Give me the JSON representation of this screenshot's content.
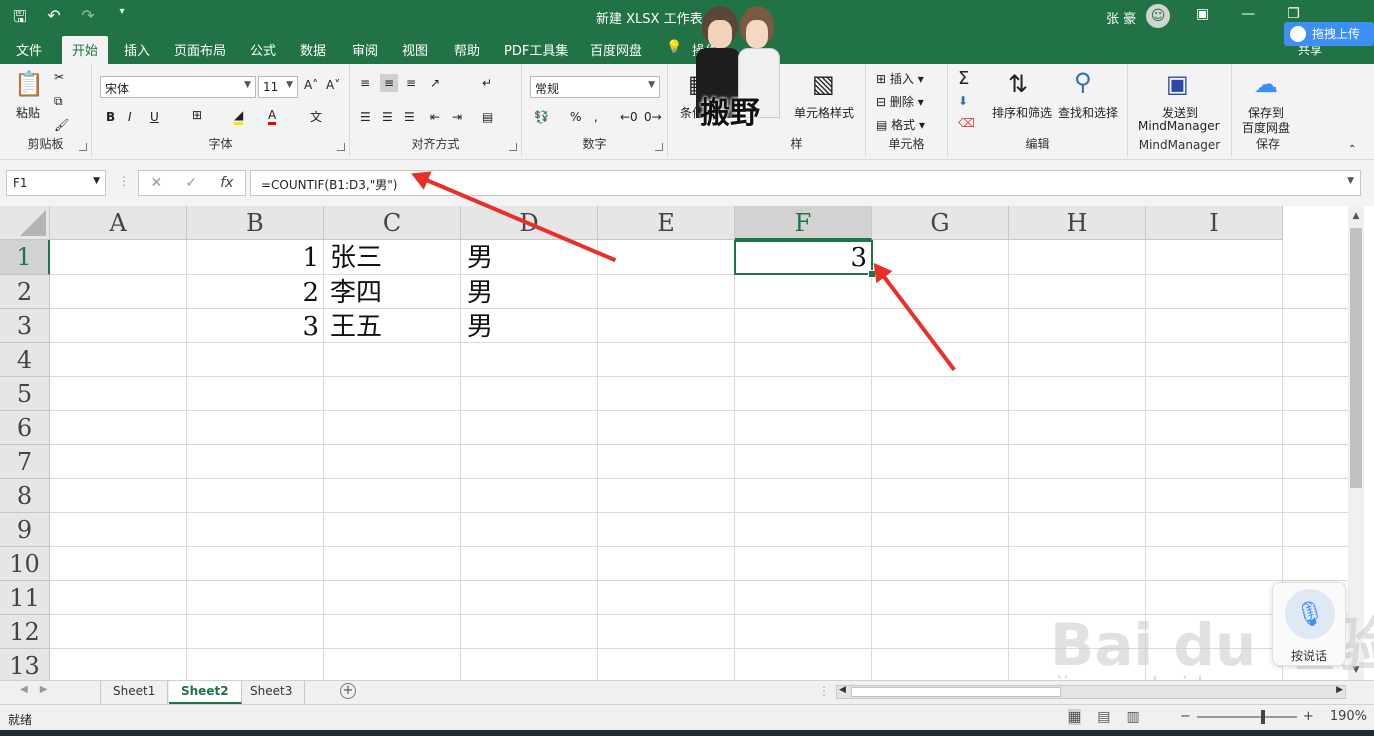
{
  "titlebar": {
    "doc_title": "新建 XLSX 工作表.x",
    "user_name": "张 豪",
    "qat": {
      "save_icon": "save-icon",
      "undo_icon": "undo-icon",
      "redo_icon": "redo-icon"
    },
    "window_buttons": [
      "minimize",
      "restore",
      "close"
    ]
  },
  "tabs": [
    "文件",
    "开始",
    "插入",
    "页面布局",
    "公式",
    "数据",
    "审阅",
    "视图",
    "帮助",
    "PDF工具集",
    "百度网盘",
    "操作"
  ],
  "active_tab": "开始",
  "share_label": "共享",
  "baidu_upload_label": "拖拽上传",
  "ribbon": {
    "clipboard": {
      "paste": "粘贴",
      "label": "剪贴板"
    },
    "font": {
      "name": "宋体",
      "size": "11",
      "bold": "B",
      "italic": "I",
      "underline": "U",
      "label": "字体"
    },
    "alignment": {
      "label": "对齐方式"
    },
    "number": {
      "format": "常规",
      "percent": "%",
      "label": "数字"
    },
    "styles": {
      "cond": "条件",
      "cell_styles": "单元格样式",
      "label": "样"
    },
    "cells": {
      "insert": "插入",
      "delete": "删除",
      "format": "格式",
      "label": "单元格"
    },
    "editing": {
      "sort_filter": "排序和筛选",
      "find_select": "查找和选择",
      "label": "编辑"
    },
    "mindmanager": {
      "send_line1": "发送到",
      "send_line2": "MindManager",
      "label": "MindManager"
    },
    "save": {
      "line1": "保存到",
      "line2": "百度网盘",
      "label": "保存"
    }
  },
  "formula_bar": {
    "name_box": "F1",
    "cancel": "✕",
    "enter": "✓",
    "fx": "fx",
    "formula": "=COUNTIF(B1:D3,\"男\")"
  },
  "grid": {
    "columns": [
      "A",
      "B",
      "C",
      "D",
      "E",
      "F",
      "G",
      "H",
      "I"
    ],
    "rows": [
      "1",
      "2",
      "3",
      "4",
      "5",
      "6",
      "7",
      "8",
      "9",
      "10",
      "11",
      "12",
      "13"
    ],
    "selected_column": "F",
    "selected_row": "1",
    "cells": {
      "B1": "1",
      "C1": "张三",
      "D1": "男",
      "B2": "2",
      "C2": "李四",
      "D2": "男",
      "B3": "3",
      "C3": "王五",
      "D3": "男",
      "F1": "3"
    }
  },
  "sheets": [
    "Sheet1",
    "Sheet2",
    "Sheet3"
  ],
  "active_sheet": "Sheet2",
  "status": {
    "ready": "就绪",
    "zoom": "190%"
  },
  "voice_widget": {
    "label": "按说话"
  },
  "watermark": {
    "line1": "Bai du 经验",
    "line2": "jingyan.baidu.com"
  },
  "sticker": {
    "text": "搬野"
  },
  "colors": {
    "accent": "#217346",
    "annotation_arrow": "#e8302a",
    "baidu_blue": "#3b8ff6"
  }
}
